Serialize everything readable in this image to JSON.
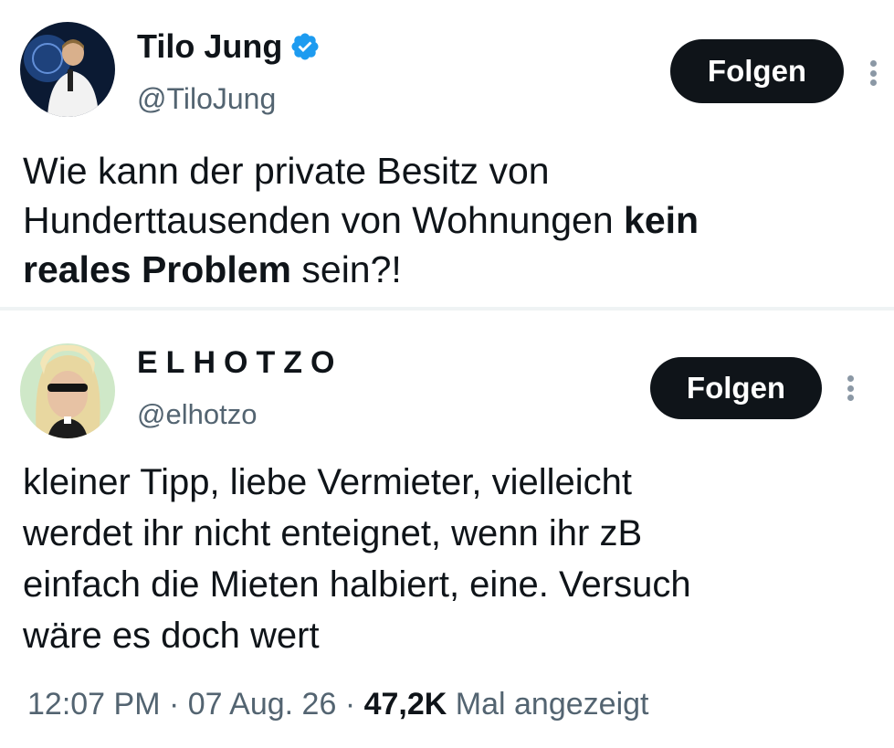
{
  "tweet1": {
    "display_name": "Tilo Jung",
    "handle": "@TiloJung",
    "verified": true,
    "follow_label": "Folgen",
    "text": {
      "line1": "Wie kann der private Besitz von",
      "line2_plain": "Hunderttausenden von Wohnungen ",
      "line2_bold": "kein",
      "line3_bold": "reales Problem",
      "line3_plain": " sein?!"
    }
  },
  "tweet2": {
    "display_name": "ELHOTZO",
    "handle": "@elhotzo",
    "follow_label": "Folgen",
    "text": {
      "line1": "kleiner Tipp, liebe Vermieter, vielleicht",
      "line2": "werdet ihr nicht enteignet, wenn ihr zB",
      "line3": "einfach die Mieten halbiert, eine. Versuch",
      "line4": "wäre es doch wert"
    }
  },
  "meta": {
    "time": "12:07 PM",
    "separator": "·",
    "date": "07 Aug. 26",
    "views_count": "47,2K",
    "views_label": " Mal angezeigt"
  },
  "colors": {
    "primary_text": "#0f1419",
    "secondary_text": "#536471",
    "verified_blue": "#1d9bf0",
    "button_bg": "#0f1419"
  }
}
